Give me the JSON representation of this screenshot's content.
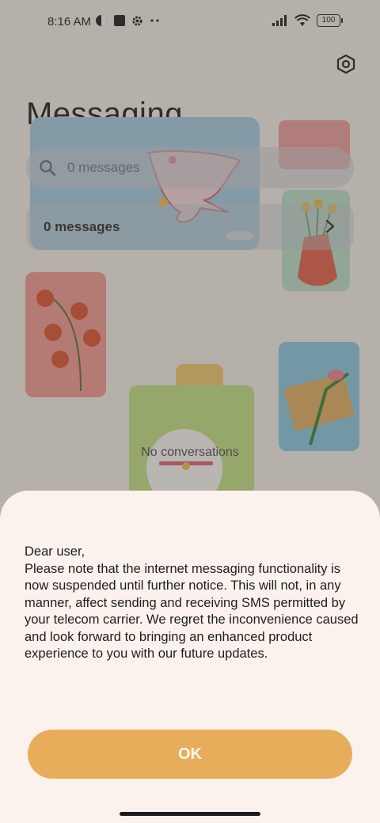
{
  "status_bar": {
    "time": "8:16 AM",
    "battery": "100"
  },
  "header": {
    "title": "Messaging"
  },
  "search": {
    "placeholder": "0 messages"
  },
  "summary": {
    "label": "0 messages"
  },
  "empty_state": {
    "text": "No conversations"
  },
  "dialog": {
    "message": "Dear user,\nPlease note that the internet messaging functionality is now suspended until further notice. This will not, in any manner, affect sending and receiving SMS permitted by your telecom carrier. We regret the inconvenience caused and look forward to bringing an enhanced product experience to you with our future updates.",
    "ok_label": "OK"
  },
  "colors": {
    "accent": "#e8ad5a",
    "sheet_bg": "#fbf2ee"
  }
}
